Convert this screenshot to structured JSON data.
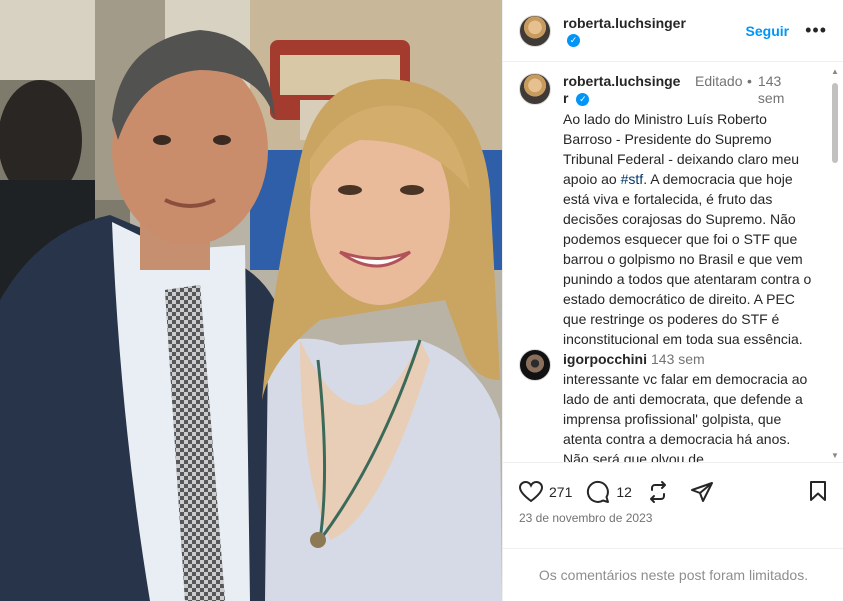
{
  "header": {
    "username": "roberta.luchsinger",
    "follow_label": "Seguir",
    "more_label": "•••"
  },
  "caption": {
    "username": "roberta.luchsinger",
    "edited": "Editado",
    "separator": "•",
    "time": "143 sem",
    "text_before": "Ao lado do Ministro Luís Roberto Barroso - Presidente do Supremo Tribunal Federal - deixando claro meu apoio ao ",
    "hashtag": "#stf",
    "text_after": ". A democracia que hoje está viva e fortalecida, é fruto das decisões corajosas do Supremo. Não podemos esquecer que foi o STF que barrou o golpismo no Brasil e que vem punindo a todos que atentaram contra o estado democrático de direito. A PEC que restringe os poderes do STF é inconstitucional em toda sua essência."
  },
  "comment": {
    "username": "igorpocchini",
    "time": "143 sem",
    "text": "interessante vc falar em democracia ao lado de anti democrata, que defende a imprensa profissional' golpista, que atenta contra a democracia há anos. Não será que olvou de"
  },
  "actions": {
    "likes": "271",
    "comments": "12"
  },
  "post_date": "23 de novembro de 2023",
  "comments_limited": "Os comentários neste post foram limitados.",
  "icons": [
    "verified-badge-icon",
    "heart-icon",
    "comment-icon",
    "repost-icon",
    "share-icon",
    "bookmark-icon",
    "scroll-up-icon",
    "scroll-down-icon"
  ],
  "colors": {
    "accent": "#0095f6",
    "text": "#262626",
    "muted": "#737373",
    "hashtag": "#00376b"
  }
}
